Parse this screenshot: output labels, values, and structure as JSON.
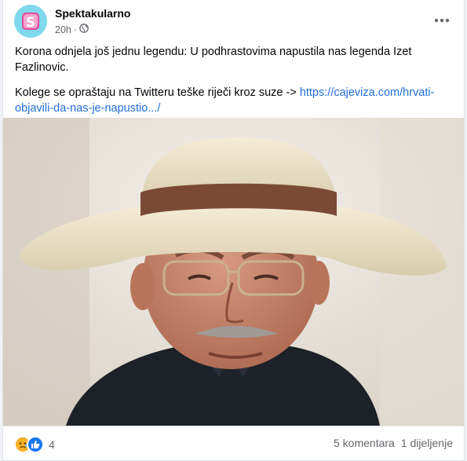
{
  "post": {
    "page_name": "Spektakularno",
    "time": "20h",
    "separator": "·",
    "privacy_icon": "globe-icon",
    "more_icon": "ellipsis-icon",
    "text_line1": "Korona odnjela još jednu legendu: U podhrastovima napustila nas legenda Izet Fazlinovic.",
    "text_line2_prefix": "Kolege se opraštaju na Twitteru teške riječi kroz suze -> ",
    "link": "https://cajeviza.com/hrvati-objavili-da-nas-je-napustio.../"
  },
  "footer": {
    "reaction_icons": [
      "sad-emoji-icon",
      "like-icon"
    ],
    "reaction_count": "4",
    "comments": "5 komentara",
    "shares": "1 dijeljenje"
  },
  "colors": {
    "link": "#216fdb",
    "secondary_text": "#65676b",
    "like_blue": "#1877f2",
    "sad_yellow": "#f7b125"
  }
}
